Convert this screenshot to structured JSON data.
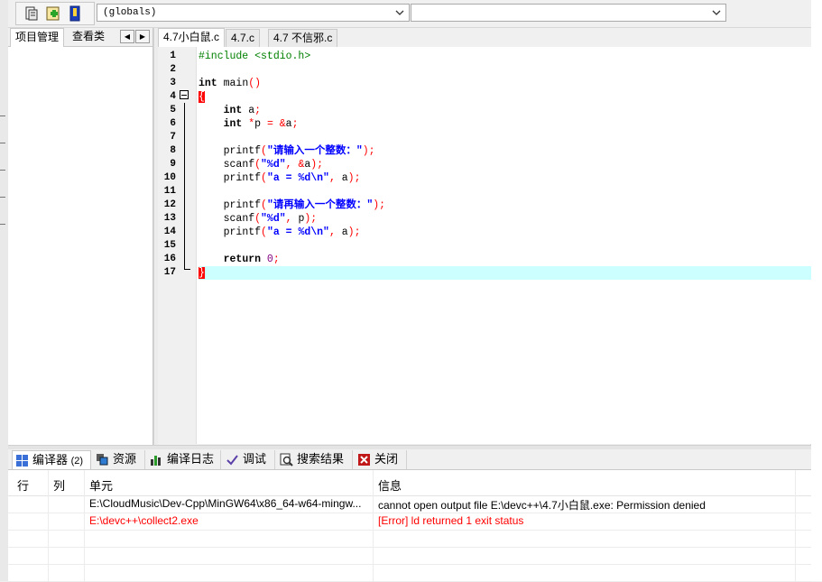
{
  "toolbar": {
    "scope_combo_value": "(globals)",
    "symbol_combo_value": ""
  },
  "project_panel": {
    "tabs": [
      {
        "label": "项目管理"
      },
      {
        "label": "查看类"
      }
    ]
  },
  "editor": {
    "tabs": [
      {
        "label": "4.7小白鼠.c"
      },
      {
        "label": "4.7.c"
      },
      {
        "label": "4.7 不信邪.c"
      }
    ],
    "line_numbers": [
      "1",
      "2",
      "3",
      "4",
      "5",
      "6",
      "7",
      "8",
      "9",
      "10",
      "11",
      "12",
      "13",
      "14",
      "15",
      "16",
      "17"
    ],
    "code": {
      "l1_a": "#include <stdio.h>",
      "l3_kw": "int",
      "l3_b": " main",
      "l3_op": "()",
      "l4_brace": "{",
      "l5_kw": "int",
      "l5_b": " a",
      "l5_op": ";",
      "l6_kw": "int",
      "l6_op1": " *",
      "l6_b": "p ",
      "l6_op2": "= &",
      "l6_c": "a",
      "l6_op3": ";",
      "l8_a": "printf",
      "l8_op1": "(",
      "l8_str": "\"请输入一个整数：\"",
      "l8_op2": ");",
      "l9_a": "scanf",
      "l9_op1": "(",
      "l9_str": "\"%d\"",
      "l9_op2": ", &",
      "l9_b": "a",
      "l9_op3": ");",
      "l10_a": "printf",
      "l10_op1": "(",
      "l10_str": "\"a = %d\\n\"",
      "l10_op2": ", ",
      "l10_b": "a",
      "l10_op3": ");",
      "l12_a": "printf",
      "l12_op1": "(",
      "l12_str": "\"请再输入一个整数：\"",
      "l12_op2": ");",
      "l13_a": "scanf",
      "l13_op1": "(",
      "l13_str": "\"%d\"",
      "l13_op2": ", ",
      "l13_b": "p",
      "l13_op3": ");",
      "l14_a": "printf",
      "l14_op1": "(",
      "l14_str": "\"a = %d\\n\"",
      "l14_op2": ", ",
      "l14_b": "a",
      "l14_op3": ");",
      "l16_kw": "return",
      "l16_num": " 0",
      "l16_op": ";",
      "l17_brace": "}"
    }
  },
  "bottom_panel": {
    "tabs": [
      {
        "label": "编译器",
        "count": "(2)",
        "icon": "grid-icon"
      },
      {
        "label": "资源",
        "icon": "resources-icon"
      },
      {
        "label": "编译日志",
        "icon": "bar-chart-icon"
      },
      {
        "label": "调试",
        "icon": "check-icon"
      },
      {
        "label": "搜索结果",
        "icon": "magnifier-icon"
      },
      {
        "label": "关闭",
        "icon": "close-icon"
      }
    ],
    "columns": [
      "行",
      "列",
      "单元",
      "信息"
    ],
    "rows": [
      {
        "line": "",
        "col": "",
        "unit": "E:\\CloudMusic\\Dev-Cpp\\MinGW64\\x86_64-w64-mingw...",
        "message": "cannot open output file E:\\devc++\\4.7小白鼠.exe: Permission denied",
        "error": false
      },
      {
        "line": "",
        "col": "",
        "unit": "E:\\devc++\\collect2.exe",
        "message": "[Error] ld returned 1 exit status",
        "error": true
      }
    ]
  },
  "colors": {
    "current_line": "#ccffff",
    "preprocessor": "#008000",
    "string": "#0000ff",
    "operator": "#ff0000",
    "number": "#800080",
    "error_text": "#ff0000"
  }
}
